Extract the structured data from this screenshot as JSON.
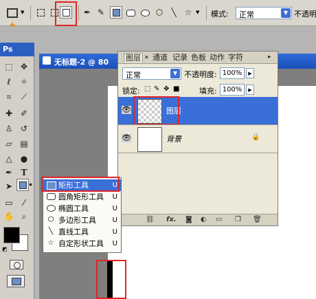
{
  "options_bar": {
    "mode_label": "模式:",
    "mode_value": "正常",
    "opacity_label": "不透明"
  },
  "document": {
    "title": "无标题-2 @ 80"
  },
  "toolbox": {
    "header": "Ps"
  },
  "layers_panel": {
    "tabs": [
      "图层",
      "通道",
      "记录",
      "色板",
      "动作",
      "字符"
    ],
    "blend_mode": "正常",
    "opacity_label": "不透明度:",
    "opacity_value": "100%",
    "lock_label": "锁定:",
    "fill_label": "填充:",
    "fill_value": "100%",
    "layers": [
      {
        "name": "图层",
        "selected": true
      },
      {
        "name": "背景",
        "selected": false
      }
    ],
    "footer_icons": [
      "link-icon",
      "fx-icon",
      "mask-icon",
      "adjustment-icon",
      "group-icon",
      "new-layer-icon",
      "trash-icon"
    ]
  },
  "shape_menu": {
    "items": [
      {
        "label": "矩形工具",
        "key": "U",
        "icon": "rectangle-icon"
      },
      {
        "label": "圆角矩形工具",
        "key": "U",
        "icon": "rounded-rect-icon"
      },
      {
        "label": "椭圆工具",
        "key": "U",
        "icon": "ellipse-icon"
      },
      {
        "label": "多边形工具",
        "key": "U",
        "icon": "polygon-icon"
      },
      {
        "label": "直线工具",
        "key": "U",
        "icon": "line-icon"
      },
      {
        "label": "自定形状工具",
        "key": "U",
        "icon": "custom-shape-icon"
      }
    ]
  },
  "colors": {
    "title_bar": "#2f6bd8",
    "selected_layer": "#3a6fd8",
    "highlight_box": "#e02424",
    "foreground": "#000000",
    "background": "#ffffff"
  }
}
